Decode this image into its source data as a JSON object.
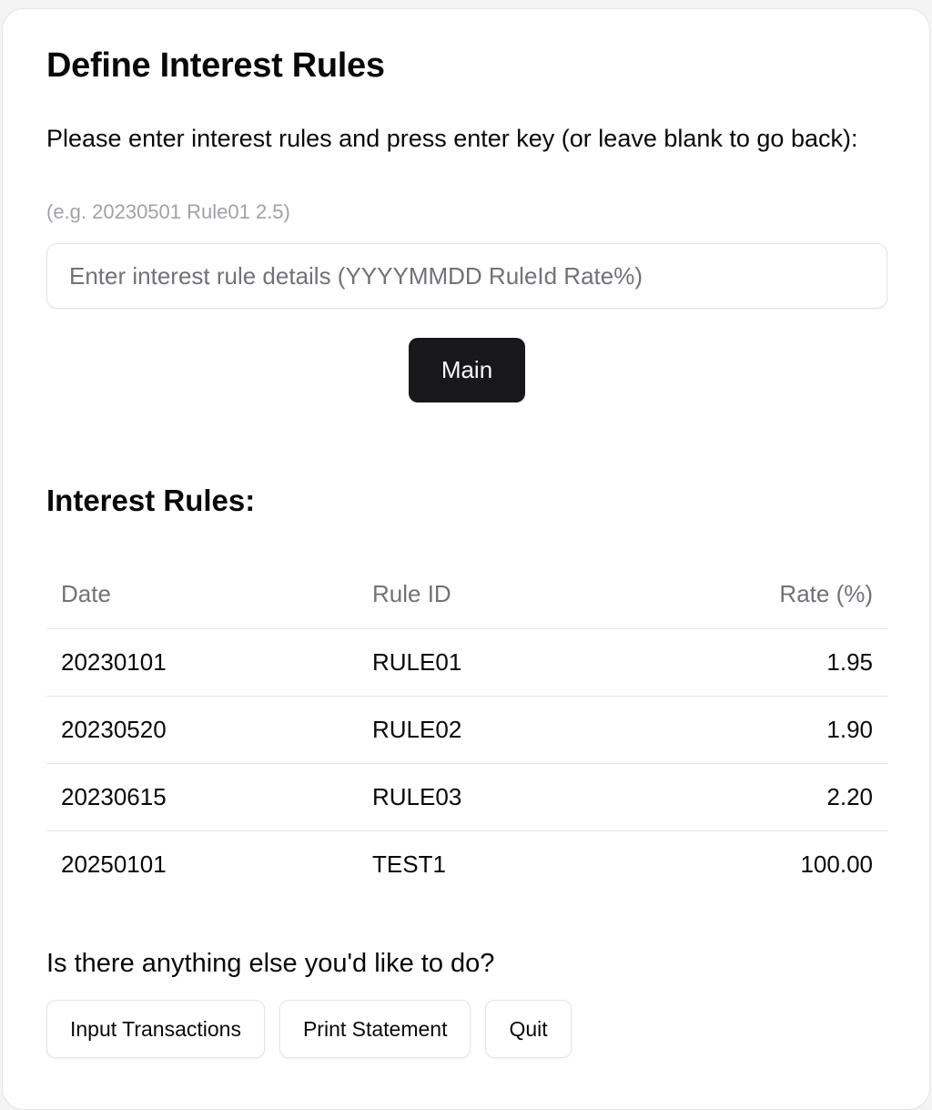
{
  "page": {
    "title": "Define Interest Rules",
    "instructions": "Please enter interest rules and press enter key (or leave blank to go back):",
    "example": "(e.g. 20230501 Rule01 2.5)"
  },
  "rule_input": {
    "value": "",
    "placeholder": "Enter interest rule details (YYYYMMDD RuleId Rate%)"
  },
  "main_button": {
    "label": "Main"
  },
  "rules_section": {
    "title": "Interest Rules:",
    "columns": [
      "Date",
      "Rule ID",
      "Rate (%)"
    ],
    "rows": [
      {
        "date": "20230101",
        "rule_id": "RULE01",
        "rate": "1.95"
      },
      {
        "date": "20230520",
        "rule_id": "RULE02",
        "rate": "1.90"
      },
      {
        "date": "20230615",
        "rule_id": "RULE03",
        "rate": "2.20"
      },
      {
        "date": "20250101",
        "rule_id": "TEST1",
        "rate": "100.00"
      }
    ]
  },
  "next_actions": {
    "question": "Is there anything else you'd like to do?",
    "buttons": [
      "Input Transactions",
      "Print Statement",
      "Quit"
    ]
  },
  "colors": {
    "primary_button": "#18181b",
    "border": "#e4e4e7",
    "muted_text": "#71717a",
    "hint_text": "#a1a1aa"
  }
}
